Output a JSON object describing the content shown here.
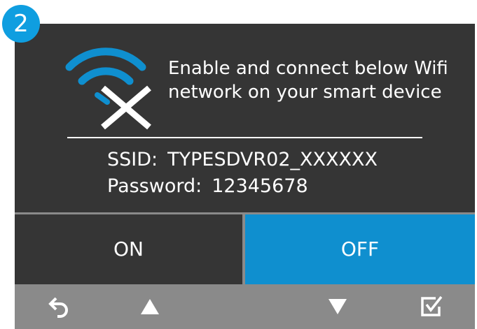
{
  "step": {
    "number": "2"
  },
  "icons": {
    "wifi": "wifi-off-icon",
    "back": "back-arrow-icon",
    "up": "triangle-up-icon",
    "down": "triangle-down-icon",
    "confirm": "checkbox-check-icon"
  },
  "colors": {
    "screen_bg": "#353535",
    "accent_blue": "#0f8fcf",
    "badge_blue": "#0f9ee0",
    "bar_gray": "#8a8a8a",
    "text": "#ffffff"
  },
  "message": {
    "line1": "Enable and connect below Wifi",
    "line2": "network on your smart device"
  },
  "credentials": {
    "ssid_label": "SSID:",
    "ssid_value": "TYPESDVR02_XXXXXX",
    "password_label": "Password:",
    "password_value": "12345678"
  },
  "toggle": {
    "on_label": "ON",
    "off_label": "OFF",
    "selected": "OFF"
  }
}
